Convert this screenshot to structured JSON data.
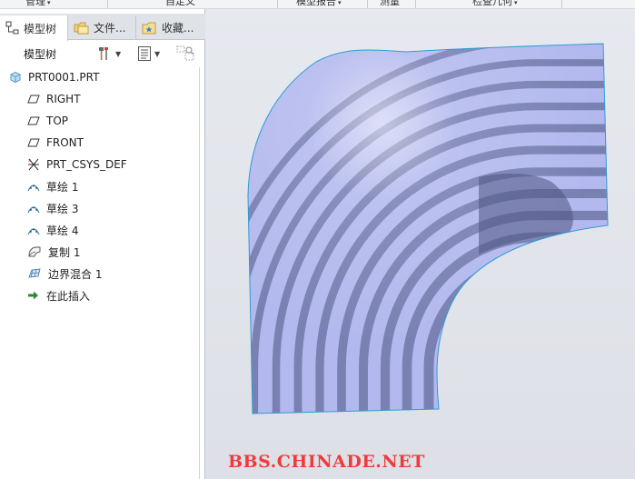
{
  "ribbon": {
    "items": [
      {
        "label": "管理",
        "has_arrow": true
      },
      {
        "label": "自定义",
        "has_arrow": false
      },
      {
        "label": "模型报告",
        "has_arrow": true
      },
      {
        "label": "测量",
        "has_arrow": false
      },
      {
        "label": "检查几何",
        "has_arrow": true
      }
    ]
  },
  "panel": {
    "tabs": [
      {
        "label": "模型树",
        "icon": "model-tree-icon",
        "active": true
      },
      {
        "label": "文件...",
        "icon": "folder-icon",
        "active": false
      },
      {
        "label": "收藏...",
        "icon": "favorites-icon",
        "active": false
      }
    ],
    "toolbar": {
      "title": "模型树",
      "settings_icon": "hammer-settings-icon",
      "show_icon": "list-show-icon",
      "filter_icon": "filter-icon"
    },
    "tree": [
      {
        "label": "PRT0001.PRT",
        "icon": "part-icon"
      },
      {
        "label": "RIGHT",
        "icon": "datum-plane-icon"
      },
      {
        "label": "TOP",
        "icon": "datum-plane-icon"
      },
      {
        "label": "FRONT",
        "icon": "datum-plane-icon"
      },
      {
        "label": "PRT_CSYS_DEF",
        "icon": "coordinate-system-icon"
      },
      {
        "label": "草绘 1",
        "icon": "sketch-icon"
      },
      {
        "label": "草绘 3",
        "icon": "sketch-icon"
      },
      {
        "label": "草绘 4",
        "icon": "sketch-icon"
      },
      {
        "label": "复制 1",
        "icon": "copy-surface-icon"
      },
      {
        "label": "边界混合 1",
        "icon": "boundary-blend-icon"
      },
      {
        "label": "在此插入",
        "icon": "insert-here-arrow-icon"
      }
    ]
  },
  "viewport": {
    "watermark": "BBS.CHINADE.NET",
    "surface_colors": {
      "light": "#b3b9ee",
      "dark": "#6e77a8",
      "edge": "#2e9bd6"
    }
  }
}
